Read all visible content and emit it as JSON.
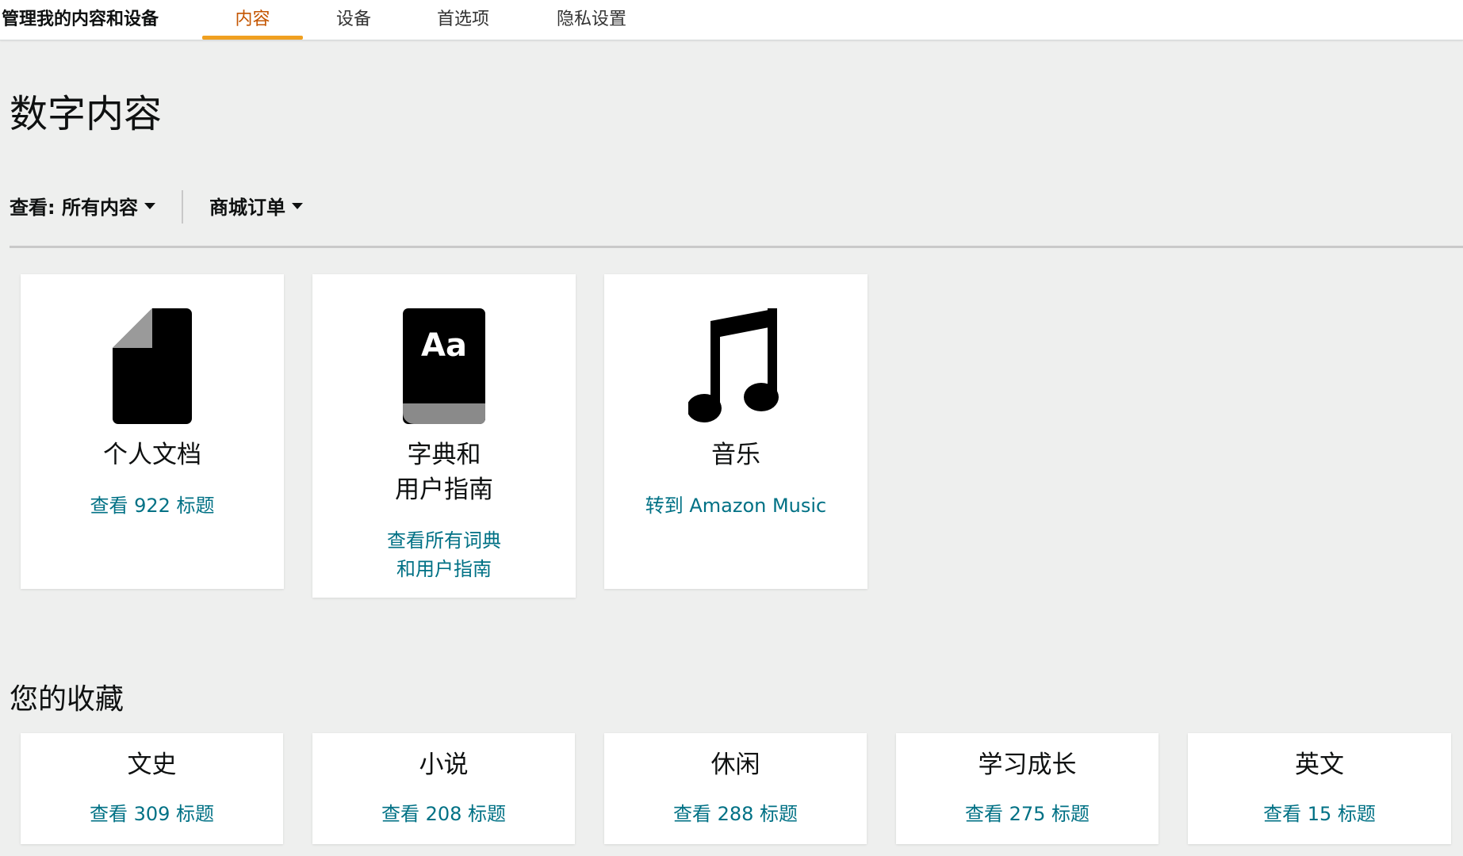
{
  "header": {
    "brand": "管理我的内容和设备",
    "tabs": [
      {
        "label": "内容",
        "active": true
      },
      {
        "label": "设备",
        "active": false
      },
      {
        "label": "首选项",
        "active": false
      },
      {
        "label": "隐私设置",
        "active": false
      }
    ]
  },
  "page_title": "数字内容",
  "filters": {
    "view": "查看: 所有内容",
    "orders": "商城订单"
  },
  "cards": [
    {
      "title": "个人文档",
      "link": "查看 922 标题",
      "icon": "document-icon"
    },
    {
      "title_line1": "字典和",
      "title_line2": "用户指南",
      "link_line1": "查看所有词典",
      "link_line2": "和用户指南",
      "icon": "dictionary-icon",
      "icon_text": "Aa"
    },
    {
      "title": "音乐",
      "link": "转到 Amazon Music",
      "icon": "music-note-icon"
    }
  ],
  "collections": {
    "title": "您的收藏",
    "items": [
      {
        "title": "文史",
        "link": "查看 309 标题"
      },
      {
        "title": "小说",
        "link": "查看 208 标题"
      },
      {
        "title": "休闲",
        "link": "查看 288 标题"
      },
      {
        "title": "学习成长",
        "link": "查看 275 标题"
      },
      {
        "title": "英文",
        "link": "查看 15 标题"
      }
    ]
  },
  "colors": {
    "link": "#007185",
    "active_tab": "#c45500",
    "tab_underline": "#f0a020",
    "background": "#eeefee"
  }
}
